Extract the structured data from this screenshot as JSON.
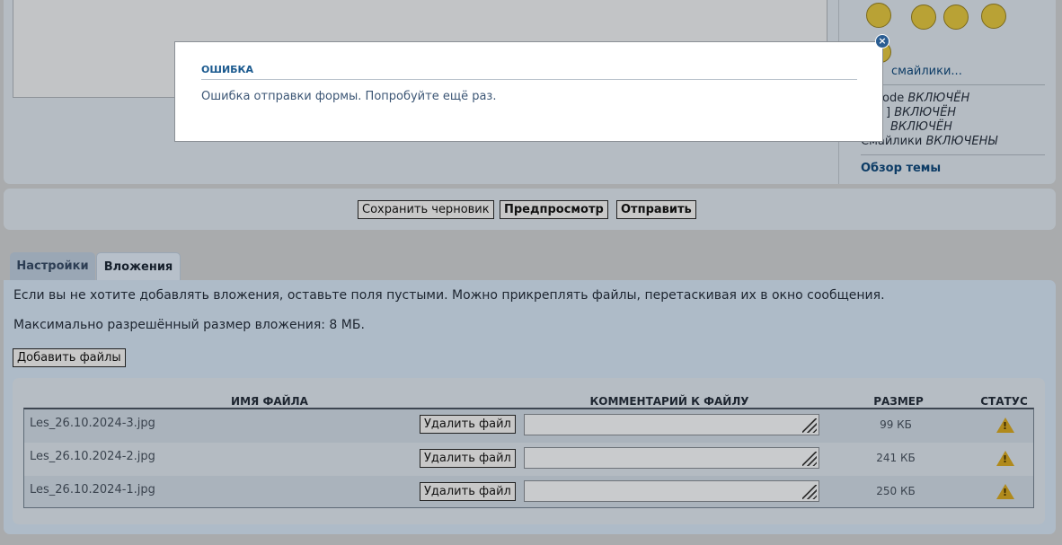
{
  "right_panel": {
    "smilies_link": "смайлики...",
    "bbcode_label": "ode",
    "bbcode_status": "ВКЛЮЧЁН",
    "img_label": "]",
    "img_status": "ВКЛЮЧЁН",
    "flash_status": "ВКЛЮЧЁН",
    "smilies_label": "Смайлики",
    "smilies_status": "ВКЛЮЧЕНЫ",
    "topic_review": "Обзор темы"
  },
  "actions": {
    "save_draft": "Сохранить черновик",
    "preview": "Предпросмотр",
    "submit": "Отправить"
  },
  "tabs": [
    {
      "label": "Настройки",
      "active": false
    },
    {
      "label": "Вложения",
      "active": true
    }
  ],
  "attachments": {
    "hint": "Если вы не хотите добавлять вложения, оставьте поля пустыми. Можно прикреплять файлы, перетаскивая их в окно сообщения.",
    "max_size": "Максимально разрешённый размер вложения: 8 МБ.",
    "add_files": "Добавить файлы",
    "columns": {
      "filename": "ИМЯ ФАЙЛА",
      "comment": "КОММЕНТАРИЙ К ФАЙЛУ",
      "size": "РАЗМЕР",
      "status": "СТАТУС"
    },
    "delete_label": "Удалить файл",
    "rows": [
      {
        "name": "Les_26.10.2024-3.jpg",
        "size": "99 КБ",
        "comment": "",
        "status_icon": "warning-icon"
      },
      {
        "name": "Les_26.10.2024-2.jpg",
        "size": "241 КБ",
        "comment": "",
        "status_icon": "warning-icon"
      },
      {
        "name": "Les_26.10.2024-1.jpg",
        "size": "250 КБ",
        "comment": "",
        "status_icon": "warning-icon"
      }
    ]
  },
  "modal": {
    "title": "ОШИБКА",
    "message": "Ошибка отправки формы. Попробуйте ещё раз.",
    "close_icon": "close-icon"
  },
  "colors": {
    "modal_title": "#1b5a8f",
    "warning": "#b08a1c"
  }
}
